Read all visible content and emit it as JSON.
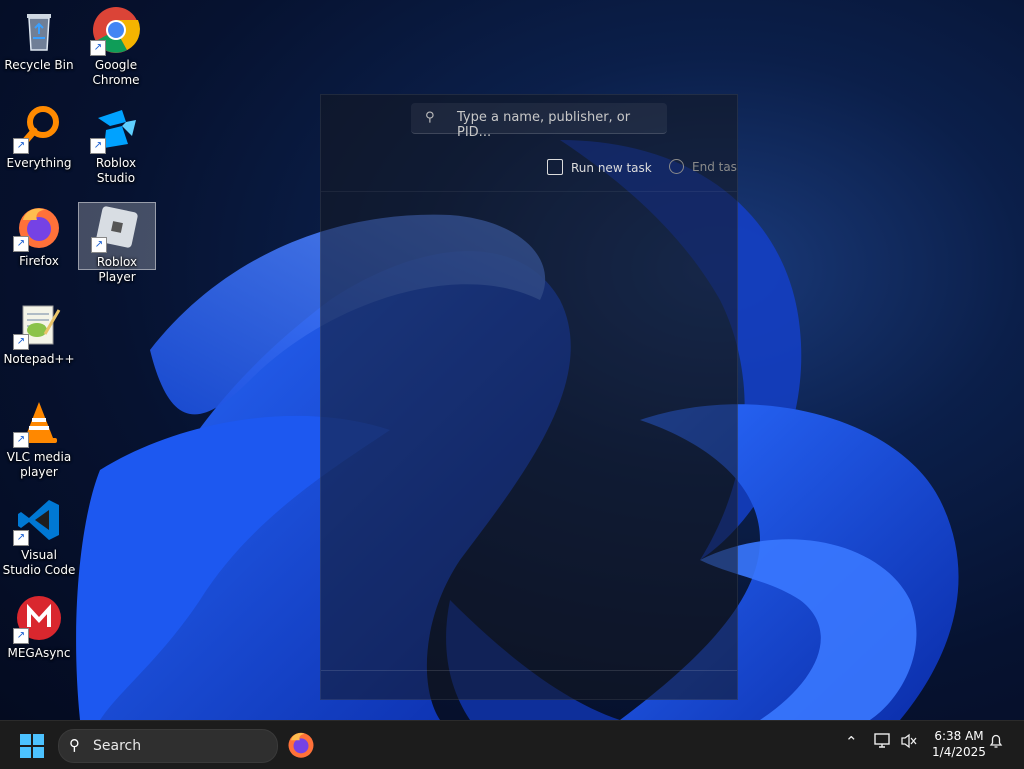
{
  "desktop": {
    "icons": [
      {
        "label": "Recycle Bin",
        "icon": "recycle-bin-icon"
      },
      {
        "label": "Google Chrome",
        "icon": "chrome-icon"
      },
      {
        "label": "Everything",
        "icon": "everything-icon"
      },
      {
        "label": "Roblox Studio",
        "icon": "roblox-studio-icon"
      },
      {
        "label": "Firefox",
        "icon": "firefox-icon"
      },
      {
        "label": "Roblox Player",
        "icon": "roblox-player-icon",
        "selected": true
      },
      {
        "label": "Notepad++",
        "icon": "notepadpp-icon"
      },
      {
        "label": "VLC media player",
        "icon": "vlc-icon"
      },
      {
        "label": "Visual Studio Code",
        "icon": "vscode-icon"
      },
      {
        "label": "MEGAsync",
        "icon": "megasync-icon"
      }
    ]
  },
  "task_manager": {
    "search_placeholder": "Type a name, publisher, or PID...",
    "run_new_task": "Run new task",
    "end_task": "End task"
  },
  "taskbar": {
    "search_label": "Search",
    "time": "6:38 AM",
    "date": "1/4/2025"
  },
  "colors": {
    "accent": "#4cc2ff",
    "taskbar_bg": "#1c1c1c"
  }
}
